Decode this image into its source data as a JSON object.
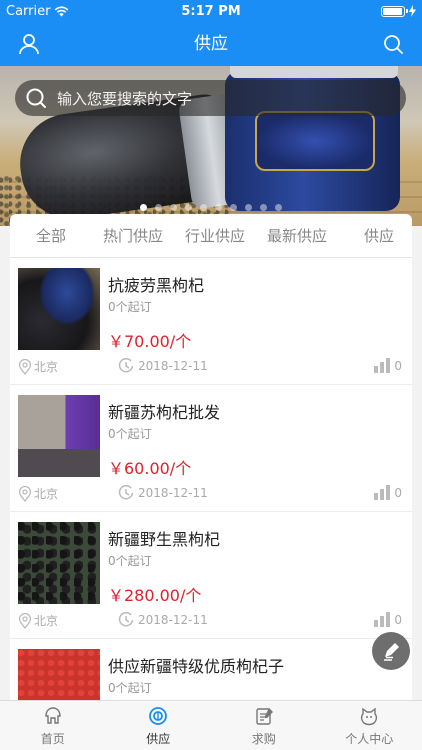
{
  "status_bar": {
    "carrier": "Carrier",
    "time": "5:17 PM",
    "battery_level": 0.95
  },
  "nav": {
    "title": "供应",
    "left_icon": "user-icon",
    "right_icon": "search-icon"
  },
  "banner": {
    "search_placeholder": "输入您要搜索的文字",
    "slide_count": 10,
    "active_slide": 0
  },
  "tabs": [
    "全部",
    "热门供应",
    "行业供应",
    "最新供应",
    "供应"
  ],
  "items": [
    {
      "title": "抗疲劳黑枸杞",
      "moq": "0个起订",
      "price": "￥70.00/个",
      "location": "北京",
      "date": "2018-12-11",
      "views": "0"
    },
    {
      "title": "新疆苏枸杞批发",
      "moq": "0个起订",
      "price": "￥60.00/个",
      "location": "北京",
      "date": "2018-12-11",
      "views": "0"
    },
    {
      "title": "新疆野生黑枸杞",
      "moq": "0个起订",
      "price": "￥280.00/个",
      "location": "北京",
      "date": "2018-12-11",
      "views": "0"
    },
    {
      "title": "供应新疆特级优质枸杞子",
      "moq": "0个起订",
      "price": "",
      "location": "",
      "date": "",
      "views": ""
    }
  ],
  "tabbar": [
    {
      "label": "首页",
      "icon": "home-icon",
      "active": false
    },
    {
      "label": "供应",
      "icon": "supply-icon",
      "active": true
    },
    {
      "label": "求购",
      "icon": "purchase-icon",
      "active": false
    },
    {
      "label": "个人中心",
      "icon": "profile-icon",
      "active": false
    }
  ],
  "colors": {
    "primary": "#1a8ef5",
    "price": "#e0212c"
  }
}
